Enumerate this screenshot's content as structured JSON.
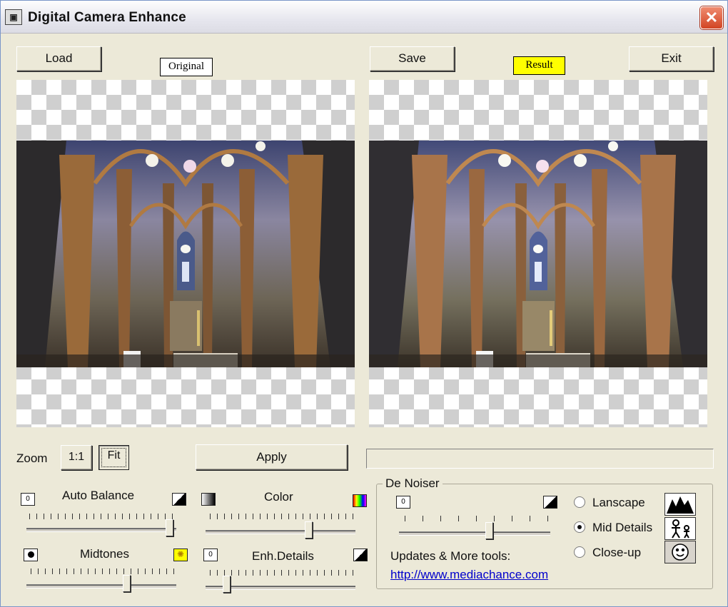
{
  "window": {
    "title": "Digital Camera Enhance",
    "icon": "camera-app-icon"
  },
  "toolbar": {
    "load_label": "Load",
    "save_label": "Save",
    "exit_label": "Exit"
  },
  "panels": {
    "original_tag": "Original",
    "result_tag": "Result",
    "result_tag_color": "#ffff00"
  },
  "zoom": {
    "label": "Zoom",
    "one_to_one_label": "1:1",
    "fit_label": "Fit"
  },
  "apply_label": "Apply",
  "sliders": {
    "auto_balance": {
      "label": "Auto Balance",
      "left_icon_text": "0",
      "value": 0.98
    },
    "color": {
      "label": "Color",
      "value": 0.7
    },
    "midtones": {
      "label": "Midtones",
      "value": 0.68
    },
    "enh_details": {
      "label": "Enh.Details",
      "left_icon_text": "0",
      "value": 0.12
    },
    "denoiser": {
      "label": "De Noiser",
      "left_icon_text": "0",
      "value": 0.6
    }
  },
  "denoiser_modes": [
    {
      "label": "Lanscape",
      "selected": false,
      "icon": "mountains-icon"
    },
    {
      "label": "Mid Details",
      "selected": true,
      "icon": "people-icon"
    },
    {
      "label": "Close-up",
      "selected": false,
      "icon": "face-icon"
    }
  ],
  "updates": {
    "text": "Updates & More tools:",
    "link": "http://www.mediachance.com"
  },
  "colors": {
    "window_bg": "#ece9d8",
    "link": "#0000cc",
    "close_button": "#d24423"
  }
}
